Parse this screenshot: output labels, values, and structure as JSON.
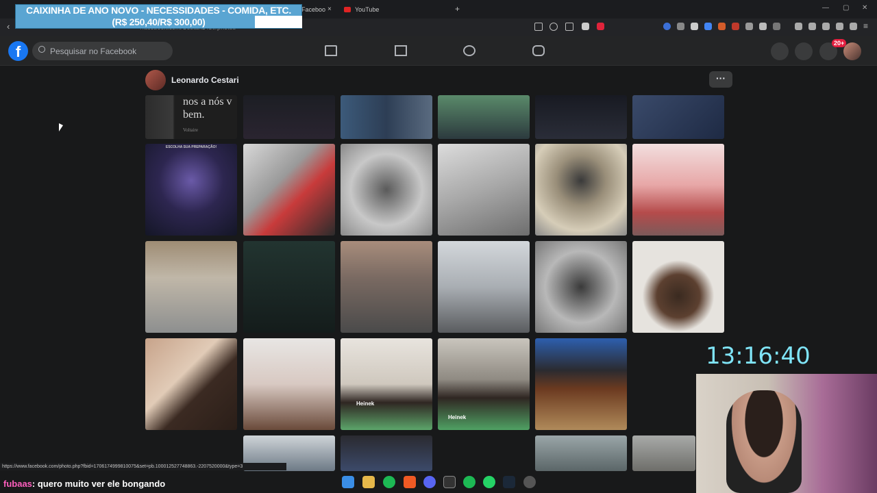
{
  "browser": {
    "tabs": [
      {
        "label": "Faceboo"
      },
      {
        "label": "YouTube"
      }
    ],
    "new_tab_label": "+",
    "address_partial": "/facebook.com/Cestari1430/photos"
  },
  "donation": {
    "line1": "CAIXINHA DE ANO NOVO - NECESSIDADES - COMIDA, ETC.",
    "line2": "(R$ 250,40/R$ 300,00)",
    "raised": 250.4,
    "goal": 300.0
  },
  "facebook": {
    "logo": "f",
    "search_placeholder": "Pesquisar no Facebook",
    "notification_count": "20+",
    "icons": [
      "home-icon",
      "marketplace-icon",
      "groups-icon",
      "gaming-icon",
      "menu-grid-icon",
      "messenger-icon",
      "bell-icon"
    ]
  },
  "album": {
    "owner_name": "Leonardo Cestari",
    "more_label": "···",
    "quote_text": "nos a nós v bem.",
    "quote_author": "Voltaire",
    "lol_label": "ESCOLHA SUA PREPARAÇÃO!",
    "beer_label": "Heinek"
  },
  "stream": {
    "timer": "13:16:40",
    "chat_user": "fubaas",
    "chat_message": ": quero muito ver ele bongando"
  },
  "statusbar": {
    "url": "https://www.facebook.com/photo.php?fbid=1706174999810075&set=pb.100012527748863.-2207520000&type=3"
  },
  "colors": {
    "facebook_blue": "#1877f2",
    "donation_bg": "#5aa5d2",
    "timer": "#7fe4f7",
    "chat_user": "#ff5fbf"
  }
}
